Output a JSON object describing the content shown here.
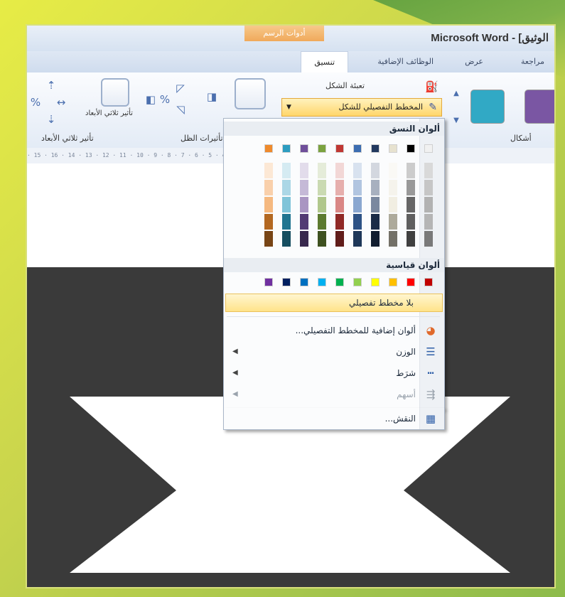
{
  "window": {
    "title": "Microsoft Word - [الوثيق"
  },
  "context_tab": {
    "label": "أدوات الرسم"
  },
  "tabs": [
    {
      "label": "تنسيق",
      "active": true
    },
    {
      "label": "الوظائف الإضافية",
      "active": false
    },
    {
      "label": "عرض",
      "active": false
    },
    {
      "label": "مراجعة",
      "active": false
    }
  ],
  "ribbon": {
    "shape_fill": "تعبئة الشكل",
    "shape_outline": "المخطط التفصيلي للشكل",
    "group_shapes": "أشكال",
    "group_3d": "تأثير ثلاثي الأبعاد",
    "btn_3d": "تأثير ثلاثي الأبعاد",
    "group_shadow": "تأثيرات الظل",
    "style_swatches": [
      "#7a56a3",
      "#31a9c5"
    ]
  },
  "ruler": {
    "text": "· 15 · 16 · 14 · 13 · 12 · 11 · 10 · 9 · 8 · 7 · 6 · 5 · 4 · 3 · 2 · 1 · 1 · 2 ·"
  },
  "menu": {
    "theme_colors_label": "ألوان النسق",
    "theme_colors": [
      "#f1f1f1",
      "#000000",
      "#e7e2cf",
      "#22395f",
      "#3c6db1",
      "#c03733",
      "#7ba23f",
      "#6f4f9a",
      "#2c9cc0",
      "#ef8a2c"
    ],
    "standard_colors_label": "ألوان قياسية",
    "standard_colors": [
      "#c00000",
      "#ff0000",
      "#ffc000",
      "#ffff00",
      "#92d050",
      "#00b050",
      "#00b0f0",
      "#0070c0",
      "#002060",
      "#7030a0"
    ],
    "no_outline": "بلا مخطط تفصيلي",
    "more_colors": "ألوان إضافية للمخطط التفصيلي...",
    "weight": "الوزن",
    "dashes": "شرَط",
    "arrows": "أسهم",
    "pattern": "النقش..."
  },
  "colors": {
    "accent_orange": "#f0a95b",
    "highlight": "#ffe38a",
    "document_shape": "#3a3a3a",
    "frame": "#c8d44d"
  }
}
